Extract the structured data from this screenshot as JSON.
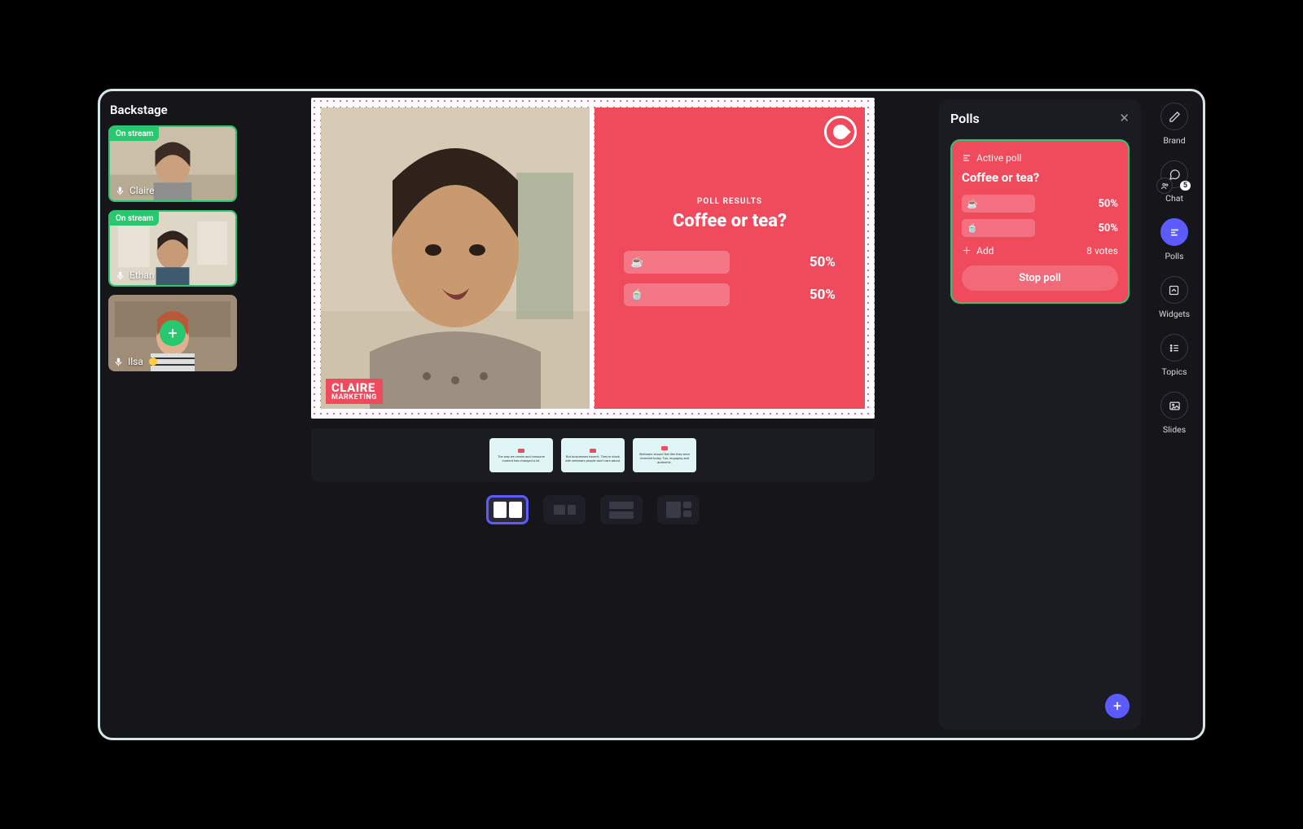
{
  "backstage": {
    "title": "Backstage",
    "on_stream_label": "On stream",
    "participants": [
      {
        "name": "Claire",
        "on_stream": true
      },
      {
        "name": "Ethan",
        "on_stream": true
      },
      {
        "name": "Ilsa",
        "on_stream": false,
        "status": "away"
      }
    ]
  },
  "stage": {
    "speaker_name": "CLAIRE",
    "speaker_role": "MARKETING",
    "poll": {
      "subtitle": "POLL RESULTS",
      "question": "Coffee or tea?",
      "options": [
        {
          "icon": "☕",
          "pct": "50%"
        },
        {
          "icon": "🍵",
          "pct": "50%"
        }
      ]
    },
    "thumbnails": [
      "The way we create and consume content has changed a lot.",
      "But businesses haven't. They're stuck with webinars people don't care about.",
      "Webinars should feel like they were invented today. Fun, engaging and authentic."
    ]
  },
  "panel": {
    "title": "Polls",
    "active_label": "Active poll",
    "question": "Coffee or tea?",
    "options": [
      {
        "icon": "☕",
        "pct": "50%"
      },
      {
        "icon": "🍵",
        "pct": "50%"
      }
    ],
    "add_label": "Add",
    "votes_label": "8 votes",
    "stop_label": "Stop poll"
  },
  "rail": {
    "items": [
      {
        "label": "Brand",
        "icon": "pencil"
      },
      {
        "label": "Chat",
        "icon": "chat",
        "badge": "5"
      },
      {
        "label": "Polls",
        "icon": "poll",
        "active": true
      },
      {
        "label": "Widgets",
        "icon": "widget"
      },
      {
        "label": "Topics",
        "icon": "list"
      },
      {
        "label": "Slides",
        "icon": "image"
      }
    ]
  }
}
